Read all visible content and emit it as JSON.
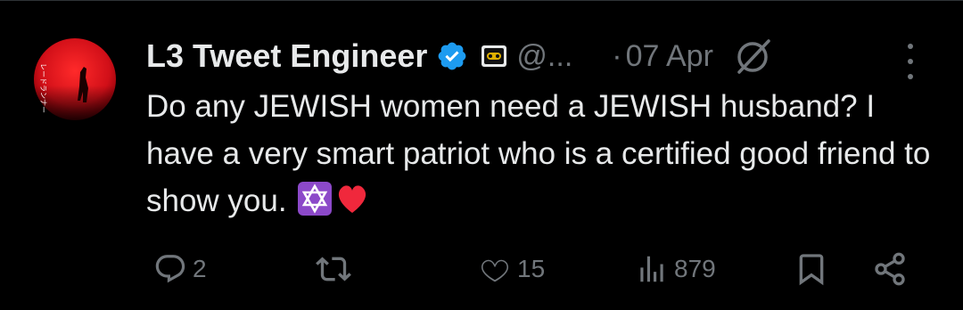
{
  "tweet": {
    "display_name": "L3 Tweet Engineer",
    "handle": "@...",
    "separator": "·",
    "date": "07 Apr",
    "text": "Do any JEWISH women need a JEWISH husband? I have a very smart patriot who is a certified good friend to show you.",
    "emojis": [
      "star-of-david",
      "red-heart"
    ],
    "verified": true
  },
  "actions": {
    "reply_count": "2",
    "retweet_count": "",
    "like_count": "15",
    "views_count": "879"
  },
  "colors": {
    "background": "#000000",
    "text": "#e7e9ea",
    "secondary": "#71767b",
    "verified_blue": "#1d9bf0",
    "avatar_red": "#e0141e"
  },
  "icons": {
    "verified": "verified-badge-icon",
    "affiliation": "affiliation-badge-icon",
    "grok": "grok-icon",
    "more": "more-icon",
    "reply": "reply-icon",
    "retweet": "retweet-icon",
    "like": "heart-icon",
    "views": "views-icon",
    "bookmark": "bookmark-icon",
    "share": "share-icon"
  }
}
